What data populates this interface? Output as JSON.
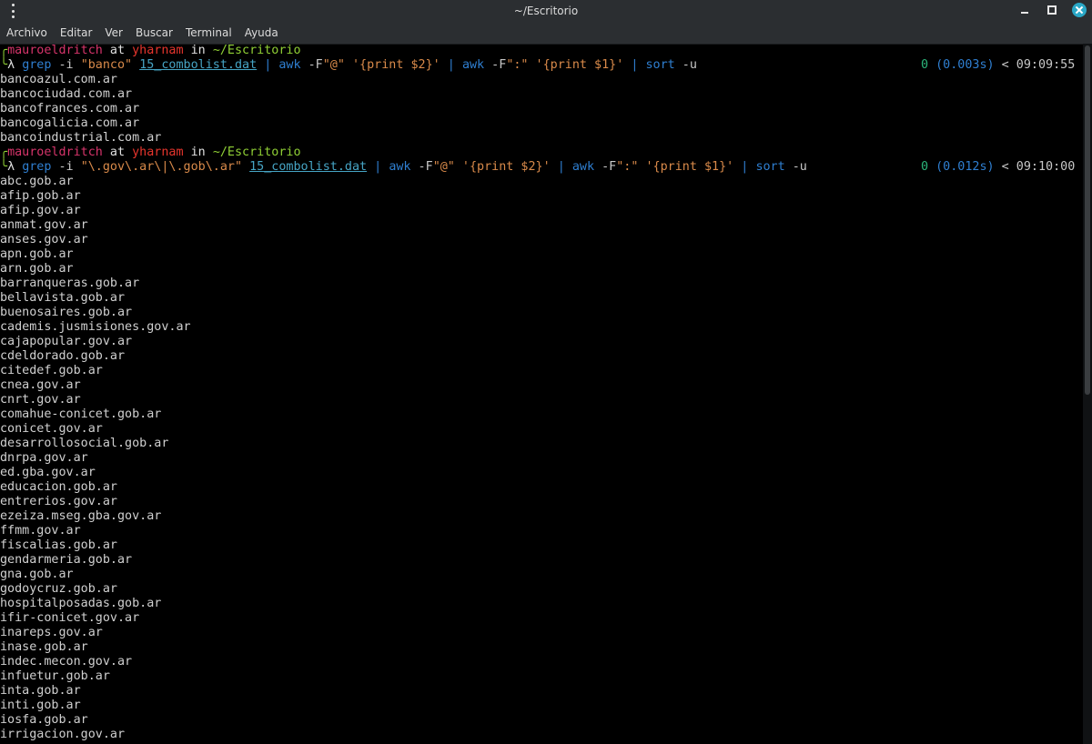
{
  "window": {
    "title": "~/Escritorio",
    "menu": [
      "Archivo",
      "Editar",
      "Ver",
      "Buscar",
      "Terminal",
      "Ayuda"
    ]
  },
  "prompts": [
    {
      "user": "mauroeldritch",
      "at": " at ",
      "host": "yharnam",
      "in": " in ",
      "path": "~/Escritorio",
      "command": {
        "grep": "grep",
        "grep_args": " -i ",
        "pattern": "\"banco\"",
        "file": "15_combolist.dat",
        "pipe1": " | ",
        "awk1": "awk",
        "awk1_flag": " -F",
        "awk1_sep": "\"@\" '{print $2}'",
        "pipe2": " | ",
        "awk2": "awk",
        "awk2_flag": " -F",
        "awk2_sep": "\":\" '{print $1}'",
        "pipe3": " | ",
        "sort": "sort",
        "sort_args": " -u"
      },
      "exit_status": "0",
      "duration": "(0.003s)",
      "clock": " < 09:09:55",
      "output": [
        "bancoazul.com.ar",
        "bancociudad.com.ar",
        "bancofrances.com.ar",
        "bancogalicia.com.ar",
        "bancoindustrial.com.ar"
      ]
    },
    {
      "user": "mauroeldritch",
      "at": " at ",
      "host": "yharnam",
      "in": " in ",
      "path": "~/Escritorio",
      "command": {
        "grep": "grep",
        "grep_args": " -i ",
        "pattern": "\"\\.gov\\.ar\\|\\.gob\\.ar\"",
        "file": "15_combolist.dat",
        "pipe1": " | ",
        "awk1": "awk",
        "awk1_flag": " -F",
        "awk1_sep": "\"@\" '{print $2}'",
        "pipe2": " | ",
        "awk2": "awk",
        "awk2_flag": " -F",
        "awk2_sep": "\":\" '{print $1}'",
        "pipe3": " | ",
        "sort": "sort",
        "sort_args": " -u"
      },
      "exit_status": "0",
      "duration": "(0.012s)",
      "clock": " < 09:10:00",
      "output": [
        "abc.gob.ar",
        "afip.gob.ar",
        "afip.gov.ar",
        "anmat.gov.ar",
        "anses.gov.ar",
        "apn.gob.ar",
        "arn.gob.ar",
        "barranqueras.gob.ar",
        "bellavista.gob.ar",
        "buenosaires.gob.ar",
        "cademis.jusmisiones.gov.ar",
        "cajapopular.gov.ar",
        "cdeldorado.gob.ar",
        "citedef.gob.ar",
        "cnea.gov.ar",
        "cnrt.gov.ar",
        "comahue-conicet.gob.ar",
        "conicet.gov.ar",
        "desarrollosocial.gob.ar",
        "dnrpa.gov.ar",
        "ed.gba.gov.ar",
        "educacion.gob.ar",
        "entrerios.gov.ar",
        "ezeiza.mseg.gba.gov.ar",
        "ffmm.gov.ar",
        "fiscalias.gob.ar",
        "gendarmeria.gob.ar",
        "gna.gob.ar",
        "godoycruz.gob.ar",
        "hospitalposadas.gob.ar",
        "ifir-conicet.gov.ar",
        "inareps.gov.ar",
        "inase.gob.ar",
        "indec.mecon.gov.ar",
        "infuetur.gob.ar",
        "inta.gob.ar",
        "inti.gob.ar",
        "iosfa.gob.ar",
        "irrigacion.gov.ar"
      ]
    }
  ],
  "colors": {
    "titlebar": "#2b2e31",
    "background": "#000000",
    "close_button": "#2aa7c6",
    "user": "#d7346b",
    "host": "#e8352d",
    "path": "#90d035",
    "command": "#2f7fd1",
    "string": "#d98a4a",
    "file": "#46a4c4",
    "exit_ok": "#2bb57a"
  },
  "icons": {
    "menu": "kebab-menu-icon",
    "minimize": "minimize-icon",
    "maximize": "maximize-icon",
    "close": "close-icon",
    "prompt_corner": "box-corner-glyph",
    "prompt_symbol": "lambda-glyph"
  }
}
